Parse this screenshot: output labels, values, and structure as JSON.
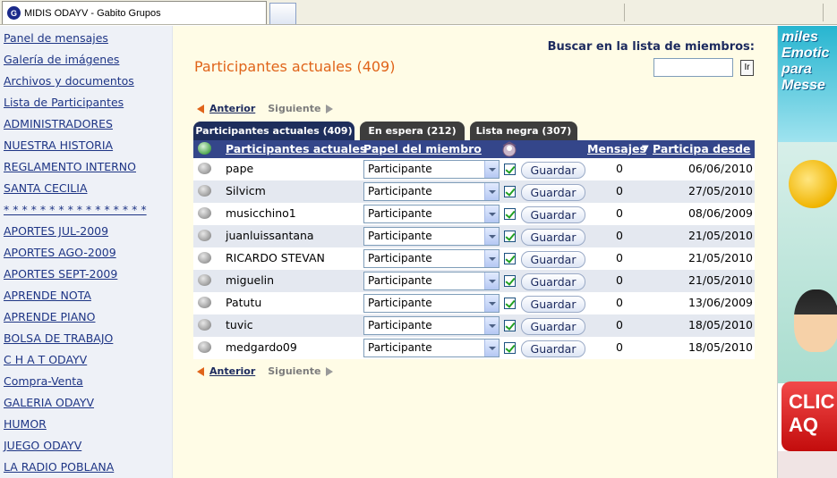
{
  "browser": {
    "tab_title": "MIDIS ODAYV - Gabito Grupos",
    "favicon_letter": "G"
  },
  "sidebar": {
    "items": [
      {
        "label": "Panel de mensajes"
      },
      {
        "label": "Galería de imágenes"
      },
      {
        "label": "Archivos y documentos"
      },
      {
        "label": "Lista de Participantes"
      },
      {
        "label": "ADMINISTRADORES"
      },
      {
        "label": "NUESTRA HISTORIA"
      },
      {
        "label": "REGLAMENTO INTERNO"
      },
      {
        "label": "SANTA CECILIA"
      },
      {
        "label": "* * * * * * * * * * * * * * * *"
      },
      {
        "label": "APORTES JUL-2009"
      },
      {
        "label": "APORTES AGO-2009"
      },
      {
        "label": "APORTES SEPT-2009"
      },
      {
        "label": "APRENDE NOTA"
      },
      {
        "label": "APRENDE PIANO"
      },
      {
        "label": "BOLSA DE TRABAJO"
      },
      {
        "label": "C H A T ODAYV"
      },
      {
        "label": "Compra-Venta"
      },
      {
        "label": "GALERIA ODAYV"
      },
      {
        "label": "HUMOR"
      },
      {
        "label": "JUEGO ODAYV"
      },
      {
        "label": "LA RADIO POBLANA"
      }
    ]
  },
  "main": {
    "title": "Participantes actuales (409)",
    "search": {
      "label": "Buscar en la lista de miembros:",
      "value": "",
      "button_label": "Ir"
    },
    "pager": {
      "prev_label": "Anterior",
      "next_label": "Siguiente"
    },
    "tabs": [
      {
        "label": "Participantes actuales (409)",
        "active": true
      },
      {
        "label": "En espera (212)",
        "active": false
      },
      {
        "label": "Lista negra (307)",
        "active": false
      }
    ],
    "table": {
      "headers": {
        "name": "Participantes actuales",
        "role": "Papel del miembro",
        "messages": "Mensajes",
        "since": "Participa desde"
      },
      "sort_indicator": "▼",
      "rows": [
        {
          "name": "pape",
          "role": "Participante",
          "checked": true,
          "save_label": "Guardar",
          "messages": "0",
          "since": "06/06/2010"
        },
        {
          "name": "Silvicm",
          "role": "Participante",
          "checked": true,
          "save_label": "Guardar",
          "messages": "0",
          "since": "27/05/2010"
        },
        {
          "name": "musicchino1",
          "role": "Participante",
          "checked": true,
          "save_label": "Guardar",
          "messages": "0",
          "since": "08/06/2009"
        },
        {
          "name": "juanluissantana",
          "role": "Participante",
          "checked": true,
          "save_label": "Guardar",
          "messages": "0",
          "since": "21/05/2010"
        },
        {
          "name": "RICARDO STEVAN",
          "role": "Participante",
          "checked": true,
          "save_label": "Guardar",
          "messages": "0",
          "since": "21/05/2010"
        },
        {
          "name": "miguelin",
          "role": "Participante",
          "checked": true,
          "save_label": "Guardar",
          "messages": "0",
          "since": "21/05/2010"
        },
        {
          "name": "Patutu",
          "role": "Participante",
          "checked": true,
          "save_label": "Guardar",
          "messages": "0",
          "since": "13/06/2009"
        },
        {
          "name": "tuvic",
          "role": "Participante",
          "checked": true,
          "save_label": "Guardar",
          "messages": "0",
          "since": "18/05/2010"
        },
        {
          "name": "medgardo09",
          "role": "Participante",
          "checked": true,
          "save_label": "Guardar",
          "messages": "0",
          "since": "18/05/2010"
        }
      ]
    }
  },
  "ad": {
    "top_text": "miles Emotic para Messe",
    "button_text": "CLIC AQ"
  },
  "colors": {
    "accent_orange": "#e0641a",
    "nav_blue": "#1e3585",
    "table_header": "#34468a",
    "active_tab": "#1e2e5c",
    "inactive_tab": "#3d3d3d",
    "content_bg": "#fffce6"
  }
}
